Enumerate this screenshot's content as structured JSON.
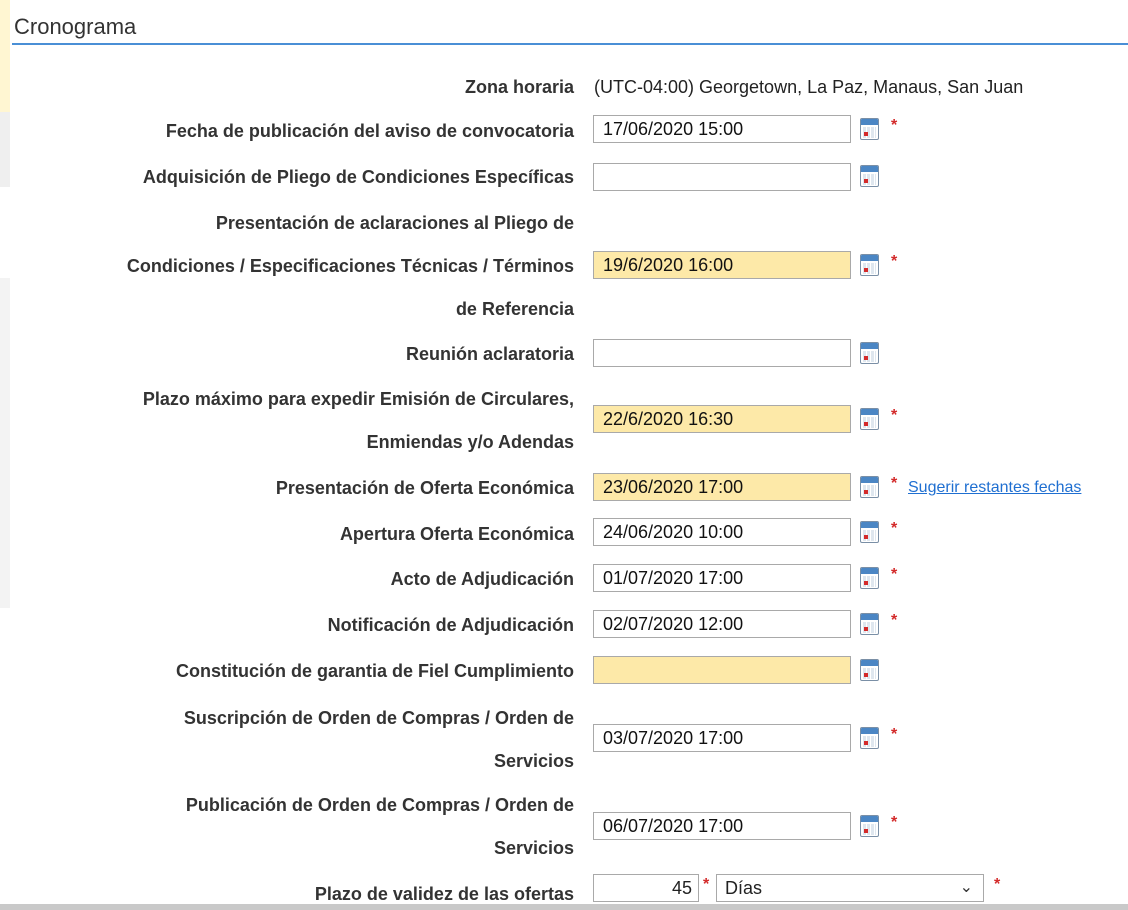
{
  "section": {
    "title": "Cronograma"
  },
  "zona": {
    "label": "Zona horaria",
    "value": "(UTC-04:00) Georgetown, La Paz, Manaus, San Juan"
  },
  "rows": [
    {
      "label": "Fecha de publicación del aviso de convocatoria",
      "value": "17/06/2020 15:00",
      "required": "*",
      "highlighted": false
    },
    {
      "label": "Adquisición de Pliego de Condiciones Específicas",
      "value": "",
      "required": "",
      "highlighted": false
    },
    {
      "label_lines": [
        "Presentación de aclaraciones al Pliego de",
        "Condiciones / Especificaciones Técnicas / Términos",
        "de Referencia"
      ],
      "value": "19/6/2020 16:00",
      "required": "*",
      "highlighted": true
    },
    {
      "label": "Reunión aclaratoria",
      "value": "",
      "required": "",
      "highlighted": false
    },
    {
      "label_lines": [
        "Plazo máximo para expedir Emisión de Circulares,",
        "Enmiendas y/o Adendas"
      ],
      "value": "22/6/2020 16:30",
      "required": "*",
      "highlighted": true
    },
    {
      "label": "Presentación de Oferta Económica",
      "value": "23/06/2020 17:00",
      "required": "*",
      "highlighted": true,
      "link": "Sugerir restantes fechas"
    },
    {
      "label": "Apertura Oferta Económica",
      "value": "24/06/2020 10:00",
      "required": "*",
      "highlighted": false
    },
    {
      "label": "Acto de Adjudicación",
      "value": "01/07/2020 17:00",
      "required": "*",
      "highlighted": false
    },
    {
      "label": "Notificación de Adjudicación",
      "value": "02/07/2020 12:00",
      "required": "*",
      "highlighted": false
    },
    {
      "label": "Constitución de garantia de Fiel Cumplimiento",
      "value": "",
      "required": "",
      "highlighted": true
    },
    {
      "label_lines": [
        "Suscripción de Orden de Compras / Orden de",
        "Servicios"
      ],
      "value": "03/07/2020 17:00",
      "required": "*",
      "highlighted": false
    },
    {
      "label_lines": [
        "Publicación de Orden de Compras / Orden de",
        "Servicios"
      ],
      "value": "06/07/2020 17:00",
      "required": "*",
      "highlighted": false
    }
  ],
  "validez": {
    "label": "Plazo de validez de las ofertas",
    "value": "45",
    "required": "*",
    "unit": "Días",
    "unit_required": "*"
  },
  "icons": {
    "calendar": "calendar-icon",
    "dropdown": "chevron-down-icon"
  },
  "colors": {
    "accent": "#4a8fd6",
    "highlight": "#fde9a8",
    "required": "#d32a2a",
    "link": "#1f6fd1"
  }
}
